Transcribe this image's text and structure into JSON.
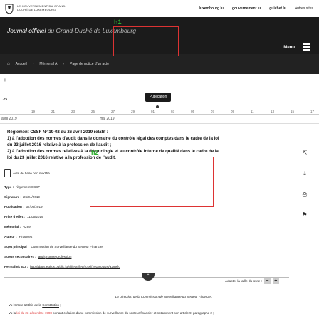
{
  "gov": {
    "logo_text": "Le gouvernement du Grand-Duché de Luxembourg",
    "links": [
      "luxembourg.lu",
      "gouvernement.lu",
      "guichet.lu"
    ],
    "other_sites": "Autres sites"
  },
  "header": {
    "title_main": "Journal officiel",
    "title_sub": " du Grand-Duché de Luxembourg",
    "menu_label": "Menu"
  },
  "breadcrumb": [
    "Accueil",
    "Mémorial A",
    "Page de notice d'un acte"
  ],
  "timeline": {
    "selected_label": "Publication",
    "month_left": "avril 2019",
    "month_right": "mai 2019",
    "days": [
      "19",
      "21",
      "23",
      "25",
      "27",
      "29",
      "01",
      "03",
      "05",
      "07",
      "09",
      "11",
      "13",
      "15",
      "17"
    ]
  },
  "document": {
    "title_lines": [
      "Règlement CSSF N° 19-02 du 26 avril 2019 relatif :",
      "1) à l'adoption des normes d'audit dans le domaine du contrôle légal des comptes dans le cadre de la loi",
      "du 23 juillet 2016 relative à la profession de l'audit ;",
      "2) à l'adoption des normes relatives à la déontologie et au contrôle interne de qualité dans le cadre de la",
      "loi du 23 juillet 2016 relative à la profession de l'audit."
    ],
    "green_tags": [
      "h1",
      "h2"
    ],
    "base_act": "Acte de base non modifié",
    "meta": {
      "type": {
        "label": "Type :",
        "value": "règlement CSSF"
      },
      "signature": {
        "label": "Signature :",
        "value": "26/04/2019"
      },
      "publication": {
        "label": "Publication :",
        "value": "07/05/2019"
      },
      "prise_effet": {
        "label": "Prise d'effet :",
        "value": "11/05/2019"
      },
      "memorial": {
        "label": "Mémorial :",
        "value": "A299"
      },
      "auteur": {
        "label": "Auteur :",
        "value": "Finances"
      },
      "sujet_principal": {
        "label": "Sujet principal :",
        "value": "Commission de Surveillance du Secteur Financier"
      },
      "sujets_secondaires": {
        "label": "Sujets secondaires :",
        "values": [
          "audit",
          "norme",
          "profession"
        ]
      },
      "permalien": {
        "label": "Permalink ELI :",
        "value": "http://data.legilux.public.lu/eli/etat/leg/rcssf/2019/04/26/a299/jo"
      }
    },
    "text_size_label": "Adapter la taille du texte :",
    "text_size_minus": "−",
    "text_size_plus": "+",
    "collapse_icon": "chevron-up",
    "body_intro": "La Direction de la Commission de Surveillance du Secteur Financier,",
    "body_line1_prefix": "Vu l'article 108bis de la ",
    "body_line1_link": "Constitution",
    "body_line1_suffix": " ;",
    "body_line2_prefix": "Vu la ",
    "body_line2_link": "loi du 23 décembre 1998",
    "body_line2_suffix": " portant création d'une commission de surveillance du secteur financier et notamment son article 9, paragraphe 2 ;"
  }
}
